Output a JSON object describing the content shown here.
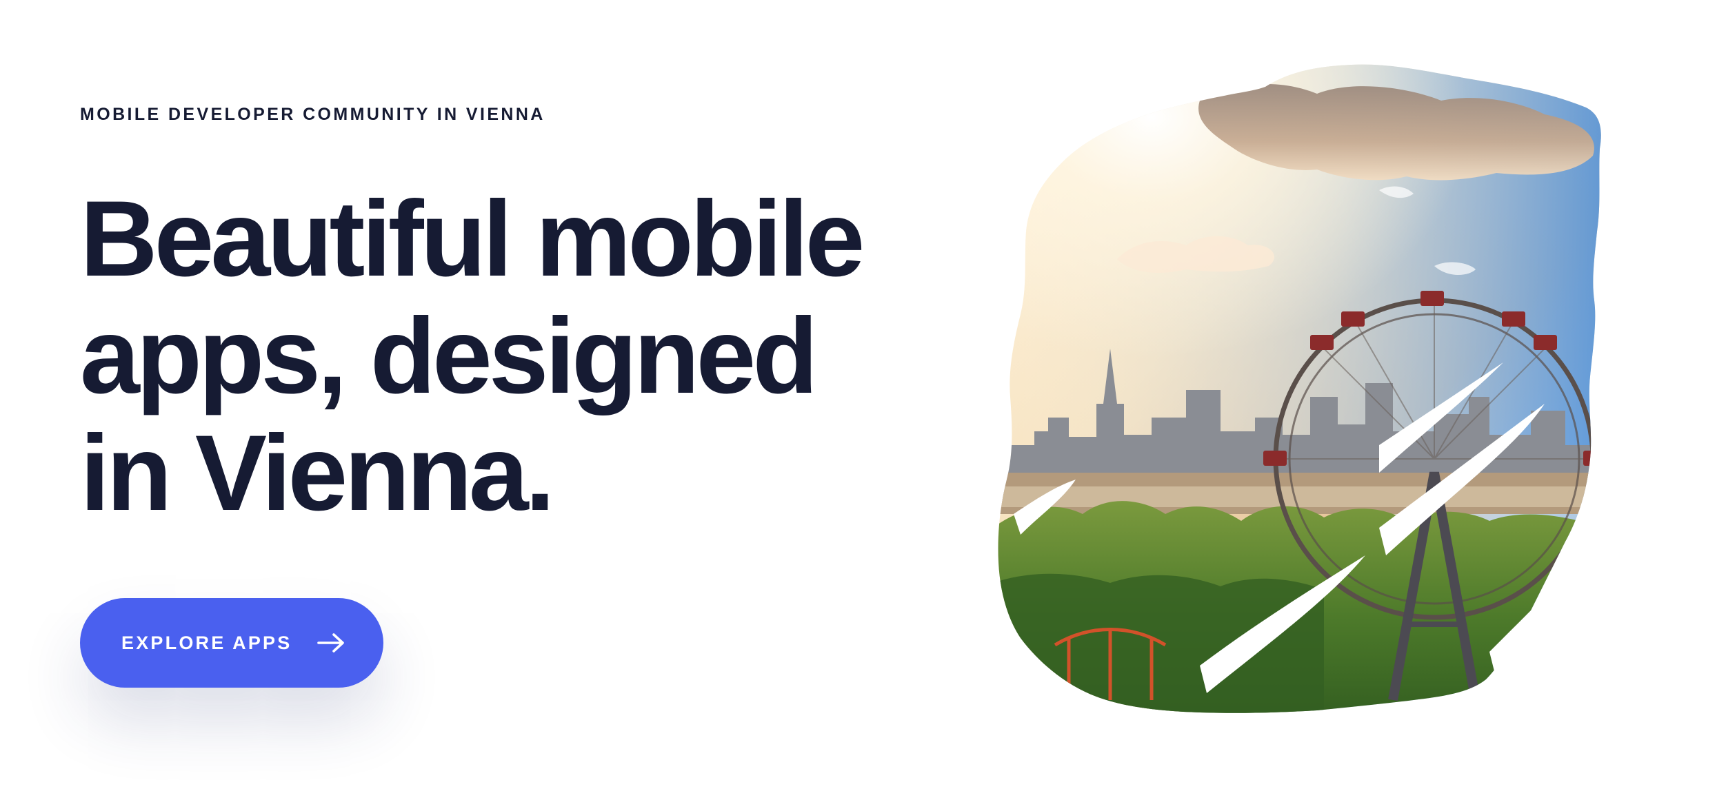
{
  "hero": {
    "eyebrow": "MOBILE DEVELOPER COMMUNITY IN VIENNA",
    "headline_lines": [
      "Beautiful mobile",
      "apps, designed",
      "in Vienna."
    ],
    "cta_label": "EXPLORE APPS",
    "cta_icon": "arrow-right-icon"
  },
  "colors": {
    "heading": "#161b33",
    "accent": "#4a60ef",
    "background": "#ffffff"
  },
  "artwork": {
    "subject": "vienna-skyline-ferris-wheel-brushstroke"
  }
}
